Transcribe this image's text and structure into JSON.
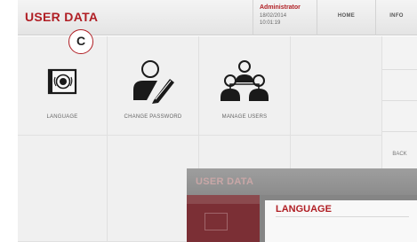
{
  "header": {
    "title": "USER DATA",
    "user": {
      "name": "Administrator",
      "date": "18/02/2014",
      "time": "10:01:19"
    },
    "home_label": "HOME",
    "info_label": "INFO"
  },
  "tiles": [
    {
      "label": "LANGUAGE",
      "icon": "flag-icon"
    },
    {
      "label": "CHANGE PASSWORD",
      "icon": "user-pencil-icon"
    },
    {
      "label": "MANAGE USERS",
      "icon": "users-group-icon"
    }
  ],
  "sidebar": {
    "back_label": "BACK"
  },
  "callout": {
    "label": "C"
  },
  "inset": {
    "title": "USER DATA",
    "panel_title": "LANGUAGE"
  },
  "colors": {
    "accent": "#b01e24",
    "tile_bg": "#f0f0f0",
    "header_bg": "#ececec"
  }
}
